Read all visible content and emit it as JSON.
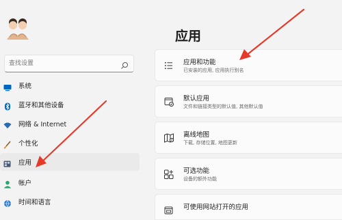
{
  "sidebar": {
    "search_placeholder": "查找设置",
    "items": [
      {
        "label": "系统",
        "icon": "monitor-icon"
      },
      {
        "label": "蓝牙和其他设备",
        "icon": "bluetooth-icon"
      },
      {
        "label": "网络 & Internet",
        "icon": "wifi-icon"
      },
      {
        "label": "个性化",
        "icon": "brush-icon"
      },
      {
        "label": "应用",
        "icon": "apps-icon",
        "active": true
      },
      {
        "label": "帐户",
        "icon": "person-icon"
      },
      {
        "label": "时间和语言",
        "icon": "globe-clock-icon"
      }
    ]
  },
  "main": {
    "title": "应用",
    "cards": [
      {
        "title": "应用和功能",
        "subtitle": "已安装的应用, 应用执行别名",
        "icon": "list-icon"
      },
      {
        "title": "默认应用",
        "subtitle": "文件和链接类型的默认值, 其他默认值",
        "icon": "default-apps-icon"
      },
      {
        "title": "离线地图",
        "subtitle": "下载, 存储位置, 地图更新",
        "icon": "map-icon"
      },
      {
        "title": "可选功能",
        "subtitle": "设备的额外功能",
        "icon": "optional-features-icon"
      },
      {
        "title": "可使用网站打开的应用",
        "subtitle": "",
        "icon": "web-apps-icon"
      }
    ]
  },
  "colors": {
    "background": "#f3f3f3",
    "card": "#fbfbfb",
    "accent_blue": "#0067c0",
    "annotation_red": "#e53a2a"
  }
}
